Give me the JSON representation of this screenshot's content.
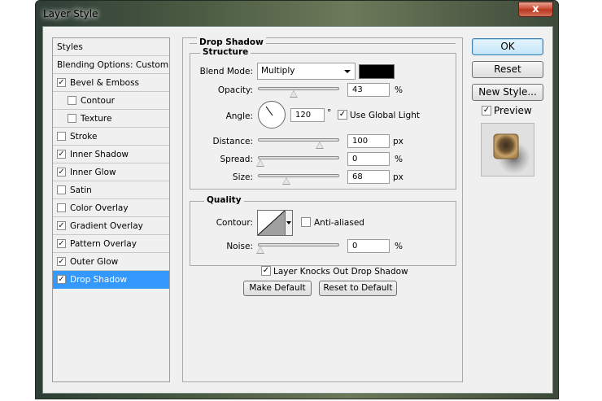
{
  "window": {
    "title": "Layer Style",
    "close_glyph": "x"
  },
  "sidebar": {
    "items": [
      {
        "label": "Styles",
        "checkbox": false,
        "checked": false,
        "level": 0,
        "selected": false
      },
      {
        "label": "Blending Options: Custom",
        "checkbox": false,
        "checked": false,
        "level": 0,
        "selected": false
      },
      {
        "label": "Bevel & Emboss",
        "checkbox": true,
        "checked": true,
        "level": 1,
        "selected": false
      },
      {
        "label": "Contour",
        "checkbox": true,
        "checked": false,
        "level": 2,
        "selected": false
      },
      {
        "label": "Texture",
        "checkbox": true,
        "checked": false,
        "level": 2,
        "selected": false
      },
      {
        "label": "Stroke",
        "checkbox": true,
        "checked": false,
        "level": 1,
        "selected": false
      },
      {
        "label": "Inner Shadow",
        "checkbox": true,
        "checked": true,
        "level": 1,
        "selected": false
      },
      {
        "label": "Inner Glow",
        "checkbox": true,
        "checked": true,
        "level": 1,
        "selected": false
      },
      {
        "label": "Satin",
        "checkbox": true,
        "checked": false,
        "level": 1,
        "selected": false
      },
      {
        "label": "Color Overlay",
        "checkbox": true,
        "checked": false,
        "level": 1,
        "selected": false
      },
      {
        "label": "Gradient Overlay",
        "checkbox": true,
        "checked": true,
        "level": 1,
        "selected": false
      },
      {
        "label": "Pattern Overlay",
        "checkbox": true,
        "checked": true,
        "level": 1,
        "selected": false
      },
      {
        "label": "Outer Glow",
        "checkbox": true,
        "checked": true,
        "level": 1,
        "selected": false
      },
      {
        "label": "Drop Shadow",
        "checkbox": true,
        "checked": true,
        "level": 1,
        "selected": true
      }
    ]
  },
  "drop_shadow": {
    "section_title": "Drop Shadow",
    "structure_title": "Structure",
    "blend_mode_label": "Blend Mode:",
    "blend_mode_value": "Multiply",
    "shadow_color": "#000000",
    "opacity_label": "Opacity:",
    "opacity_value": "43",
    "opacity_unit": "%",
    "angle_label": "Angle:",
    "angle_value": "120",
    "angle_unit": "°",
    "use_global_light_label": "Use Global Light",
    "use_global_light_checked": true,
    "distance_label": "Distance:",
    "distance_value": "100",
    "distance_unit": "px",
    "spread_label": "Spread:",
    "spread_value": "0",
    "spread_unit": "%",
    "size_label": "Size:",
    "size_value": "68",
    "size_unit": "px",
    "quality_title": "Quality",
    "contour_label": "Contour:",
    "anti_aliased_label": "Anti-aliased",
    "anti_aliased_checked": false,
    "noise_label": "Noise:",
    "noise_value": "0",
    "noise_unit": "%",
    "knocks_out_label": "Layer Knocks Out Drop Shadow",
    "knocks_out_checked": true,
    "make_default_label": "Make Default",
    "reset_default_label": "Reset to Default"
  },
  "actions": {
    "ok_label": "OK",
    "reset_label": "Reset",
    "new_style_label": "New Style...",
    "preview_label": "Preview",
    "preview_checked": true
  }
}
